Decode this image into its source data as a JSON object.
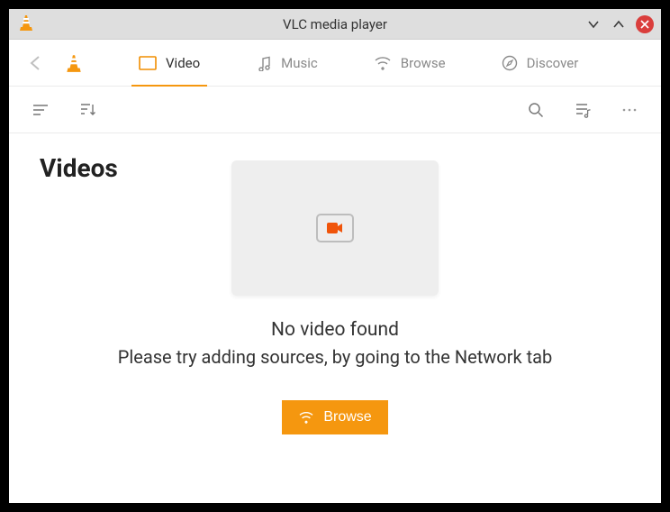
{
  "titlebar": {
    "title": "VLC media player"
  },
  "tabs": {
    "video": "Video",
    "music": "Music",
    "browse": "Browse",
    "discover": "Discover"
  },
  "page": {
    "heading": "Videos",
    "empty_title": "No video found",
    "empty_subtitle": "Please try adding sources, by going to the Network tab",
    "browse_button": "Browse"
  }
}
